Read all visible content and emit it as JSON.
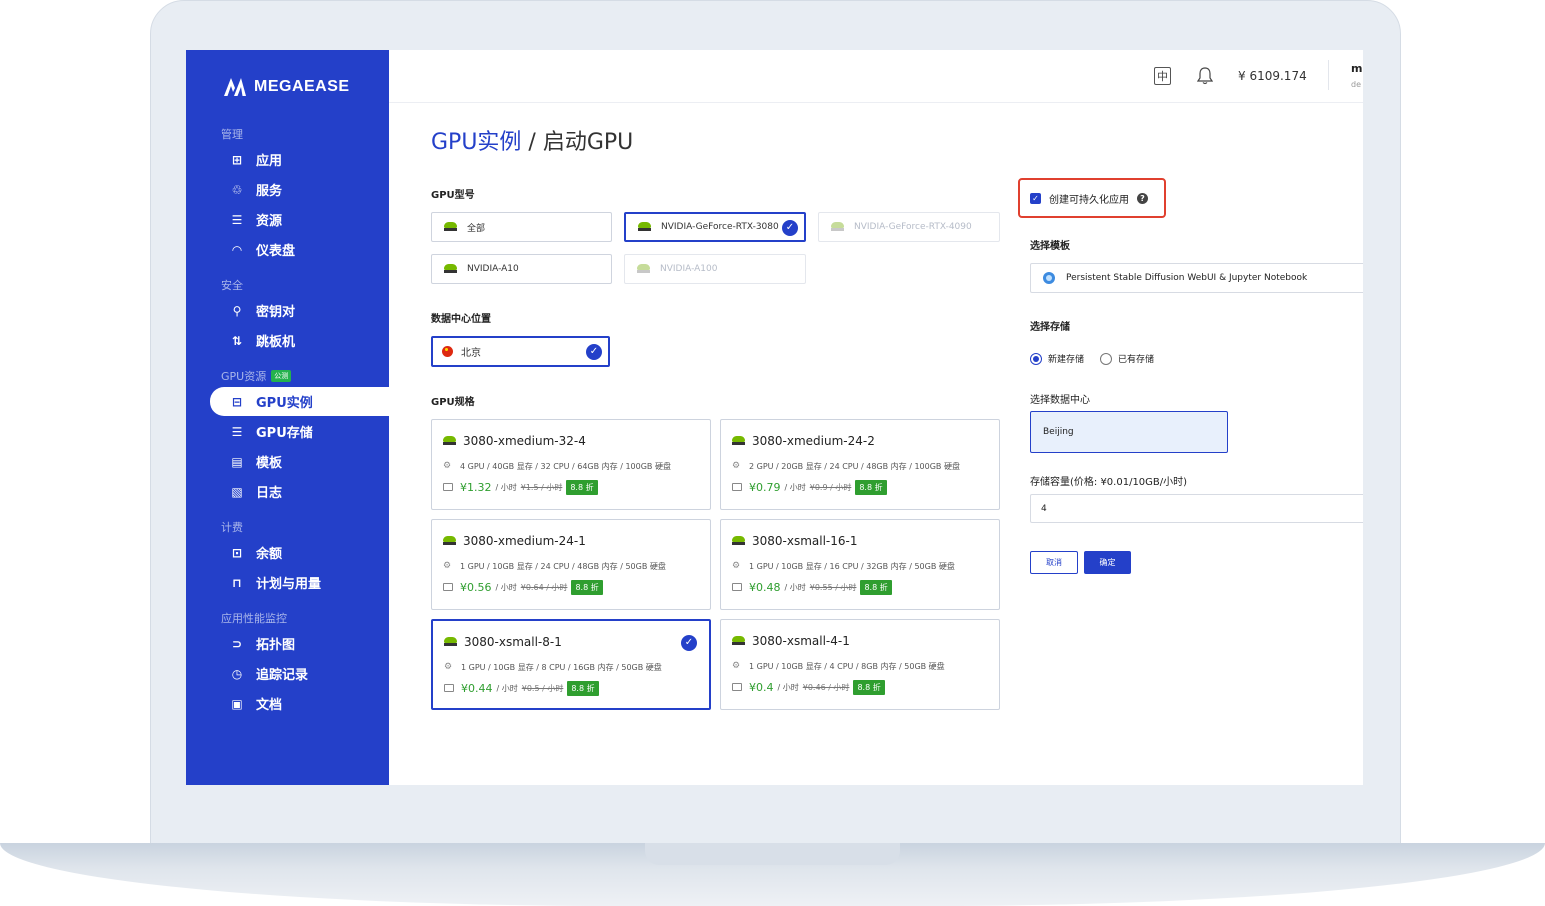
{
  "brand": {
    "name": "MEGAEASE"
  },
  "sidebar": {
    "groups": [
      {
        "title": "管理"
      },
      {
        "title": "安全"
      },
      {
        "title": "GPU资源",
        "badge": "公测"
      },
      {
        "title": "计费"
      },
      {
        "title": "应用性能监控"
      }
    ],
    "items": [
      {
        "label": "应用",
        "icon": "apps-icon"
      },
      {
        "label": "服务",
        "icon": "service-icon"
      },
      {
        "label": "资源",
        "icon": "resource-icon"
      },
      {
        "label": "仪表盘",
        "icon": "dashboard-icon"
      },
      {
        "label": "密钥对",
        "icon": "key-icon"
      },
      {
        "label": "跳板机",
        "icon": "jump-server-icon"
      },
      {
        "label": "GPU实例",
        "icon": "gpu-instance-icon"
      },
      {
        "label": "GPU存储",
        "icon": "storage-icon"
      },
      {
        "label": "模板",
        "icon": "template-icon"
      },
      {
        "label": "日志",
        "icon": "log-icon"
      },
      {
        "label": "余额",
        "icon": "balance-icon"
      },
      {
        "label": "计划与用量",
        "icon": "plan-icon"
      },
      {
        "label": "拓扑图",
        "icon": "topology-icon"
      },
      {
        "label": "追踪记录",
        "icon": "trace-icon"
      },
      {
        "label": "文档",
        "icon": "docs-icon"
      }
    ],
    "active": "GPU实例"
  },
  "topbar": {
    "language_icon": "中",
    "balance": "¥ 6109.174",
    "user_initial": "m",
    "user_sub": "de"
  },
  "page": {
    "breadcrumb_active": "GPU实例",
    "breadcrumb_sep": " / ",
    "breadcrumb_current": "启动GPU"
  },
  "form": {
    "gpu_model_label": "GPU型号",
    "gpu_models": [
      {
        "label": "全部",
        "state": "normal"
      },
      {
        "label": "NVIDIA-GeForce-RTX-3080",
        "state": "selected"
      },
      {
        "label": "NVIDIA-GeForce-RTX-4090",
        "state": "disabled"
      },
      {
        "label": "NVIDIA-A10",
        "state": "normal"
      },
      {
        "label": "NVIDIA-A100",
        "state": "disabled"
      }
    ],
    "datacenter_label": "数据中心位置",
    "datacenter_selected": "北京",
    "gpu_spec_label": "GPU规格",
    "specs": [
      {
        "name": "3080-xmedium-32-4",
        "detail": "4 GPU / 40GB 显存 / 32 CPU / 64GB 内存 / 100GB 硬盘",
        "price": "¥1.32",
        "unit": "/ 小时",
        "old_price": "¥1.5 / 小时",
        "discount": "8.8 折",
        "selected": false
      },
      {
        "name": "3080-xmedium-24-2",
        "detail": "2 GPU / 20GB 显存 / 24 CPU / 48GB 内存 / 100GB 硬盘",
        "price": "¥0.79",
        "unit": "/ 小时",
        "old_price": "¥0.9 / 小时",
        "discount": "8.8 折",
        "selected": false
      },
      {
        "name": "3080-xmedium-24-1",
        "detail": "1 GPU / 10GB 显存 / 24 CPU / 48GB 内存 / 50GB 硬盘",
        "price": "¥0.56",
        "unit": "/ 小时",
        "old_price": "¥0.64 / 小时",
        "discount": "8.8 折",
        "selected": false
      },
      {
        "name": "3080-xsmall-16-1",
        "detail": "1 GPU / 10GB 显存 / 16 CPU / 32GB 内存 / 50GB 硬盘",
        "price": "¥0.48",
        "unit": "/ 小时",
        "old_price": "¥0.55 / 小时",
        "discount": "8.8 折",
        "selected": false
      },
      {
        "name": "3080-xsmall-8-1",
        "detail": "1 GPU / 10GB 显存 / 8 CPU / 16GB 内存 / 50GB 硬盘",
        "price": "¥0.44",
        "unit": "/ 小时",
        "old_price": "¥0.5 / 小时",
        "discount": "8.8 折",
        "selected": true
      },
      {
        "name": "3080-xsmall-4-1",
        "detail": "1 GPU / 10GB 显存 / 4 CPU / 8GB 内存 / 50GB 硬盘",
        "price": "¥0.4",
        "unit": "/ 小时",
        "old_price": "¥0.46 / 小时",
        "discount": "8.8 折",
        "selected": false
      }
    ],
    "persistent_label": "创建可持久化应用",
    "persistent_checked": true,
    "template_label": "选择模板",
    "template_value": "Persistent Stable Diffusion WebUI & Jupyter Notebook",
    "storage_label": "选择存储",
    "storage_options": [
      "新建存储",
      "已有存储"
    ],
    "storage_selected": "新建存储",
    "select_dc_label": "选择数据中心",
    "select_dc_value": "Beijing",
    "capacity_label": "存储容量(价格: ¥0.01/10GB/小时)",
    "capacity_value": "4",
    "cancel_label": "取消",
    "confirm_label": "确定"
  },
  "colors": {
    "brand_blue": "#2440c9",
    "price_green": "#2f9e2f",
    "highlight_red": "#e0402f"
  }
}
